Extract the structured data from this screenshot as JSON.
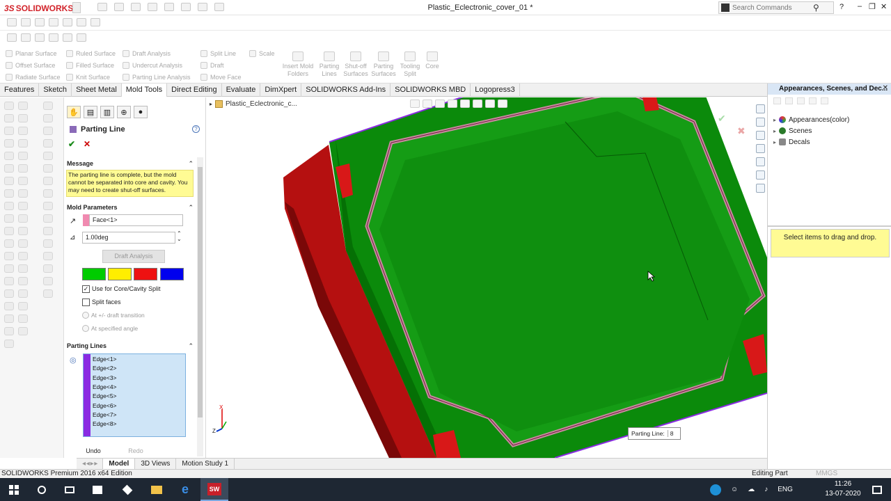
{
  "app": {
    "brand_prefix": "3S",
    "brand": "SOLIDWORKS",
    "doc_title": "Plastic_Eclectronic_cover_01 *",
    "search_placeholder": "Search Commands",
    "help_label": "?",
    "minimize": "–",
    "restore": "❐",
    "close": "✕"
  },
  "ribbon": {
    "surface_col1": [
      "Planar Surface",
      "Offset Surface",
      "Radiate Surface"
    ],
    "surface_col2": [
      "Ruled Surface",
      "Filled Surface",
      "Knit Surface"
    ],
    "analysis_col": [
      "Draft Analysis",
      "Undercut Analysis",
      "Parting Line Analysis"
    ],
    "split_col": [
      "Split Line",
      "Draft",
      "Move Face"
    ],
    "scale": "Scale",
    "big_tools": [
      {
        "line1": "Insert Mold",
        "line2": "Folders"
      },
      {
        "line1": "Parting",
        "line2": "Lines"
      },
      {
        "line1": "Shut-off",
        "line2": "Surfaces"
      },
      {
        "line1": "Parting",
        "line2": "Surfaces"
      },
      {
        "line1": "Tooling",
        "line2": "Split"
      },
      {
        "line1": "Core",
        "line2": ""
      }
    ]
  },
  "tabs": [
    "Features",
    "Sketch",
    "Sheet Metal",
    "Mold Tools",
    "Direct Editing",
    "Evaluate",
    "DimXpert",
    "SOLIDWORKS Add-Ins",
    "SOLIDWORKS MBD",
    "Logopress3"
  ],
  "active_tab": "Mold Tools",
  "property_manager": {
    "title": "Parting Line",
    "ok": "✔",
    "cancel": "✕",
    "message_header": "Message",
    "message": "The parting line is complete, but the mold cannot be separated into core and cavity. You may need to create shut-off surfaces.",
    "params_header": "Mold Parameters",
    "direction_value": "Face<1>",
    "angle_value": "1.00deg",
    "draft_btn": "Draft Analysis",
    "swatch_colors": [
      "#00cc00",
      "#ffee00",
      "#ee1111",
      "#0000ee"
    ],
    "use_core_cavity": "Use for Core/Cavity Split",
    "split_faces": "Split faces",
    "radio1": "At +/- draft transition",
    "radio2": "At specified angle",
    "parting_header": "Parting Lines",
    "edges": [
      "Edge<1>",
      "Edge<2>",
      "Edge<3>",
      "Edge<4>",
      "Edge<5>",
      "Edge<6>",
      "Edge<7>",
      "Edge<8>"
    ],
    "undo": "Undo",
    "redo": "Redo"
  },
  "viewport": {
    "breadcrumb": "Plastic_Eclectronic_c...",
    "parting_tag_label": "Parting Line:",
    "parting_tag_value": "8",
    "axis_x": "X",
    "axis_z": "Z",
    "part_red": "#c01010",
    "part_green": "#0a8a0a"
  },
  "bottom_tabs": [
    "Model",
    "3D Views",
    "Motion Study 1"
  ],
  "right_panel": {
    "title": "Appearances, Scenes, and Dec...",
    "items": [
      "Appearances(color)",
      "Scenes",
      "Decals"
    ],
    "drop_hint": "Select items to drag and drop."
  },
  "status": {
    "left": "SOLIDWORKS Premium 2016 x64 Edition",
    "mode": "Editing Part",
    "units": "MMGS"
  },
  "taskbar": {
    "lang": "ENG",
    "time": "11:26",
    "date": "13-07-2020",
    "sw_label": "SW"
  }
}
